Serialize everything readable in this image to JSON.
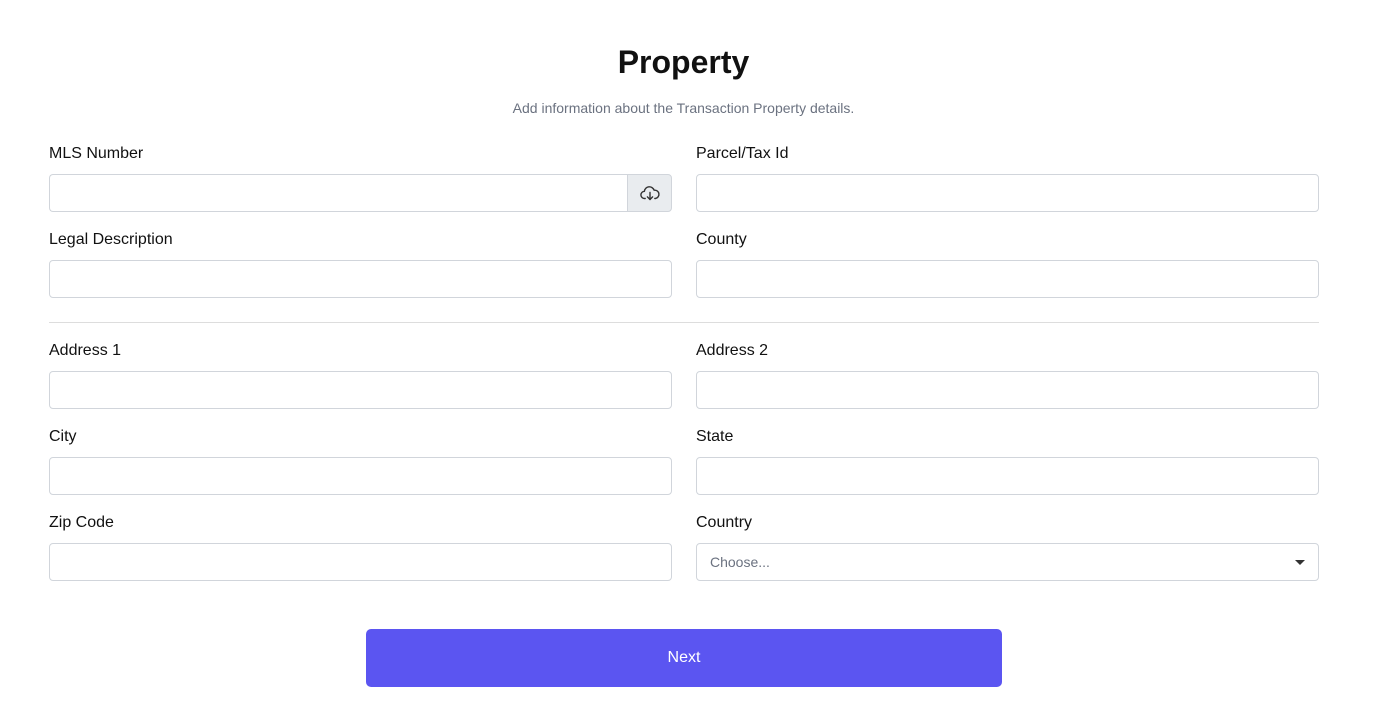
{
  "header": {
    "title": "Property",
    "subtitle": "Add information about the Transaction Property details."
  },
  "fields": {
    "mls_number": {
      "label": "MLS Number",
      "value": "",
      "addon_icon": "cloud-download-icon"
    },
    "parcel_tax_id": {
      "label": "Parcel/Tax Id",
      "value": ""
    },
    "legal_description": {
      "label": "Legal Description",
      "value": ""
    },
    "county": {
      "label": "County",
      "value": ""
    },
    "address1": {
      "label": "Address 1",
      "value": ""
    },
    "address2": {
      "label": "Address 2",
      "value": ""
    },
    "city": {
      "label": "City",
      "value": ""
    },
    "state": {
      "label": "State",
      "value": ""
    },
    "zip_code": {
      "label": "Zip Code",
      "value": ""
    },
    "country": {
      "label": "Country",
      "selected": "Choose..."
    }
  },
  "actions": {
    "next_label": "Next"
  },
  "colors": {
    "primary": "#5b55f1",
    "input_border": "#d1d5db",
    "addon_background": "#e9ecef",
    "muted_text": "#6b7280"
  }
}
